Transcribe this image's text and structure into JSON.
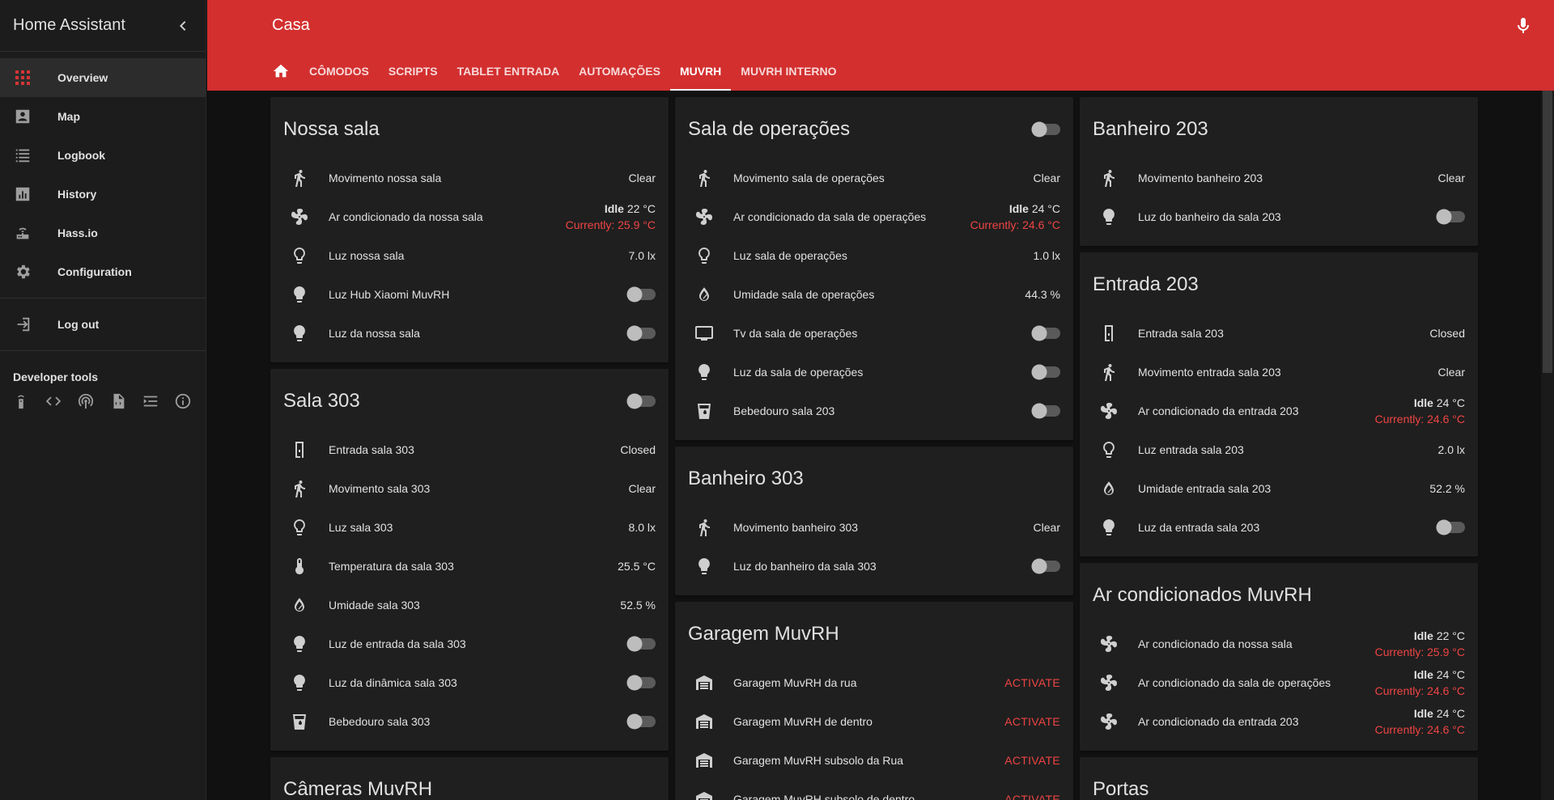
{
  "sidebar": {
    "title": "Home Assistant",
    "items": [
      {
        "label": "Overview",
        "icon": "view-dashboard-icon"
      },
      {
        "label": "Map",
        "icon": "account-box-icon"
      },
      {
        "label": "Logbook",
        "icon": "format-list-icon"
      },
      {
        "label": "History",
        "icon": "chart-box-icon"
      },
      {
        "label": "Hass.io",
        "icon": "router-icon"
      },
      {
        "label": "Configuration",
        "icon": "settings-icon"
      }
    ],
    "logout": "Log out",
    "dev_tools_title": "Developer tools"
  },
  "header": {
    "title": "Casa",
    "tabs": [
      {
        "label": "CÔMODOS"
      },
      {
        "label": "SCRIPTS"
      },
      {
        "label": "TABLET ENTRADA"
      },
      {
        "label": "AUTOMAÇÕES"
      },
      {
        "label": "MUVRH"
      },
      {
        "label": "MUVRH INTERNO"
      }
    ]
  },
  "cards": {
    "nossa_sala": {
      "title": "Nossa sala",
      "rows": [
        {
          "name": "Movimento nossa sala",
          "value": "Clear"
        },
        {
          "name": "Ar condicionado da nossa sala",
          "state": "Idle",
          "target": "22 °C",
          "current": "Currently: 25.9 °C"
        },
        {
          "name": "Luz nossa sala",
          "value": "7.0 lx"
        },
        {
          "name": "Luz Hub Xiaomi MuvRH"
        },
        {
          "name": "Luz da nossa sala"
        }
      ]
    },
    "sala_303": {
      "title": "Sala 303",
      "rows": [
        {
          "name": "Entrada sala 303",
          "value": "Closed"
        },
        {
          "name": "Movimento sala 303",
          "value": "Clear"
        },
        {
          "name": "Luz sala 303",
          "value": "8.0 lx"
        },
        {
          "name": "Temperatura da sala 303",
          "value": "25.5 °C"
        },
        {
          "name": "Umidade sala 303",
          "value": "52.5 %"
        },
        {
          "name": "Luz de entrada da sala 303"
        },
        {
          "name": "Luz da dinâmica sala 303"
        },
        {
          "name": "Bebedouro sala 303"
        }
      ]
    },
    "cameras": {
      "title": "Câmeras MuvRH"
    },
    "sala_operacoes": {
      "title": "Sala de operações",
      "rows": [
        {
          "name": "Movimento sala de operações",
          "value": "Clear"
        },
        {
          "name": "Ar condicionado da sala de operações",
          "state": "Idle",
          "target": "24 °C",
          "current": "Currently: 24.6 °C"
        },
        {
          "name": "Luz sala de operações",
          "value": "1.0 lx"
        },
        {
          "name": "Umidade sala de operações",
          "value": "44.3 %"
        },
        {
          "name": "Tv da sala de operações"
        },
        {
          "name": "Luz da sala de operações"
        },
        {
          "name": "Bebedouro sala 203"
        }
      ]
    },
    "banheiro_303": {
      "title": "Banheiro 303",
      "rows": [
        {
          "name": "Movimento banheiro 303",
          "value": "Clear"
        },
        {
          "name": "Luz do banheiro da sala 303"
        }
      ]
    },
    "garagem": {
      "title": "Garagem MuvRH",
      "action": "ACTIVATE",
      "rows": [
        {
          "name": "Garagem MuvRH da rua"
        },
        {
          "name": "Garagem MuvRH de dentro"
        },
        {
          "name": "Garagem MuvRH subsolo da Rua"
        },
        {
          "name": "Garagem MuvRH subsolo de dentro"
        }
      ]
    },
    "banheiro_203": {
      "title": "Banheiro 203",
      "rows": [
        {
          "name": "Movimento banheiro 203",
          "value": "Clear"
        },
        {
          "name": "Luz do banheiro da sala 203"
        }
      ]
    },
    "entrada_203": {
      "title": "Entrada 203",
      "rows": [
        {
          "name": "Entrada sala 203",
          "value": "Closed"
        },
        {
          "name": "Movimento entrada sala 203",
          "value": "Clear"
        },
        {
          "name": "Ar condicionado da entrada 203",
          "state": "Idle",
          "target": "24 °C",
          "current": "Currently: 24.6 °C"
        },
        {
          "name": "Luz entrada sala 203",
          "value": "2.0 lx"
        },
        {
          "name": "Umidade entrada sala 203",
          "value": "52.2 %"
        },
        {
          "name": "Luz da entrada sala 203"
        }
      ]
    },
    "ar_cond": {
      "title": "Ar condicionados MuvRH",
      "rows": [
        {
          "name": "Ar condicionado da nossa sala",
          "state": "Idle",
          "target": "22 °C",
          "current": "Currently: 25.9 °C"
        },
        {
          "name": "Ar condicionado da sala de operações",
          "state": "Idle",
          "target": "24 °C",
          "current": "Currently: 24.6 °C"
        },
        {
          "name": "Ar condicionado da entrada 203",
          "state": "Idle",
          "target": "24 °C",
          "current": "Currently: 24.6 °C"
        }
      ]
    },
    "portas": {
      "title": "Portas"
    }
  },
  "colors": {
    "accent": "#d32f2f",
    "background": "#111111",
    "card": "#1f1f1f",
    "warning_text": "#ef4444"
  }
}
